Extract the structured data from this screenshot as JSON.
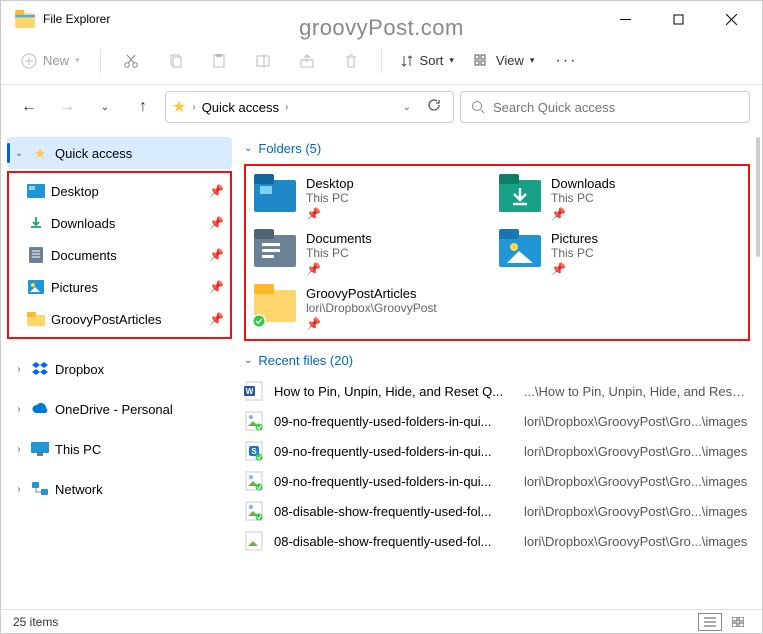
{
  "window": {
    "title": "File Explorer"
  },
  "watermark": "groovyPost.com",
  "toolbar": {
    "new": "New",
    "sort": "Sort",
    "view": "View"
  },
  "address": {
    "crumb": "Quick access",
    "search_placeholder": "Search Quick access"
  },
  "sidebar": {
    "quick_access": "Quick access",
    "items": [
      {
        "label": "Desktop"
      },
      {
        "label": "Downloads"
      },
      {
        "label": "Documents"
      },
      {
        "label": "Pictures"
      },
      {
        "label": "GroovyPostArticles"
      }
    ],
    "roots": [
      {
        "label": "Dropbox"
      },
      {
        "label": "OneDrive - Personal"
      },
      {
        "label": "This PC"
      },
      {
        "label": "Network"
      }
    ]
  },
  "sections": {
    "folders": "Folders (5)",
    "recent": "Recent files (20)"
  },
  "folders": [
    {
      "name": "Desktop",
      "sub": "This PC"
    },
    {
      "name": "Downloads",
      "sub": "This PC"
    },
    {
      "name": "Documents",
      "sub": "This PC"
    },
    {
      "name": "Pictures",
      "sub": "This PC"
    },
    {
      "name": "GroovyPostArticles",
      "sub": "lori\\Dropbox\\GroovyPost"
    }
  ],
  "recent": [
    {
      "name": "How to Pin, Unpin, Hide, and Reset Q...",
      "path": "...\\How to Pin, Unpin, Hide, and Reset ..."
    },
    {
      "name": "09-no-frequently-used-folders-in-qui...",
      "path": "lori\\Dropbox\\GroovyPost\\Gro...\\images"
    },
    {
      "name": "09-no-frequently-used-folders-in-qui...",
      "path": "lori\\Dropbox\\GroovyPost\\Gro...\\images"
    },
    {
      "name": "09-no-frequently-used-folders-in-qui...",
      "path": "lori\\Dropbox\\GroovyPost\\Gro...\\images"
    },
    {
      "name": "08-disable-show-frequently-used-fol...",
      "path": "lori\\Dropbox\\GroovyPost\\Gro...\\images"
    },
    {
      "name": "08-disable-show-frequently-used-fol...",
      "path": "lori\\Dropbox\\GroovyPost\\Gro...\\images"
    }
  ],
  "status": {
    "count": "25 items"
  }
}
